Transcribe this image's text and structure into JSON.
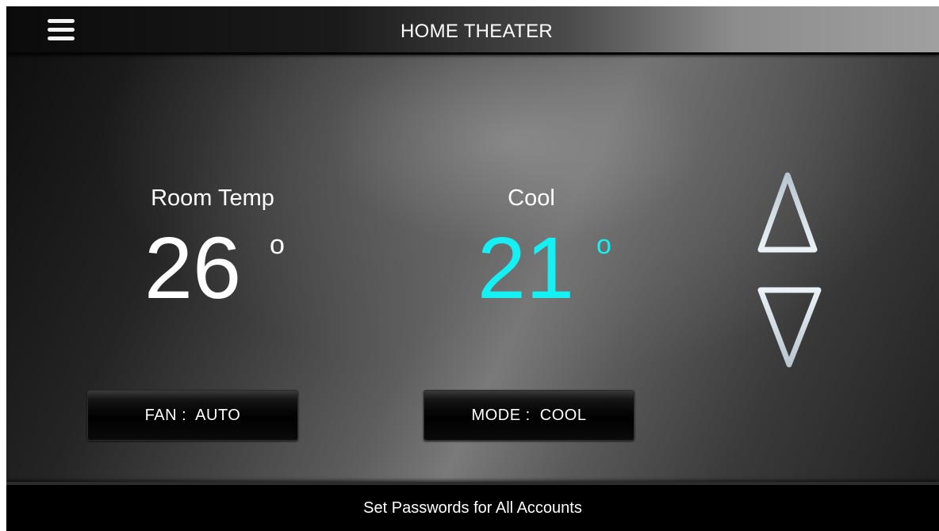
{
  "header": {
    "title": "HOME THEATER",
    "menu_icon": "hamburger-menu-icon"
  },
  "room": {
    "label": "Room Temp",
    "value": "26",
    "degree": "o"
  },
  "setpoint": {
    "label": "Cool",
    "value": "21",
    "degree": "o",
    "color": "#14f0f4"
  },
  "controls": {
    "increase_icon": "triangle-up-icon",
    "decrease_icon": "triangle-down-icon"
  },
  "buttons": {
    "fan_label": "FAN :  AUTO",
    "mode_label": "MODE :  COOL"
  },
  "footer": {
    "text": "Set Passwords for All Accounts"
  }
}
